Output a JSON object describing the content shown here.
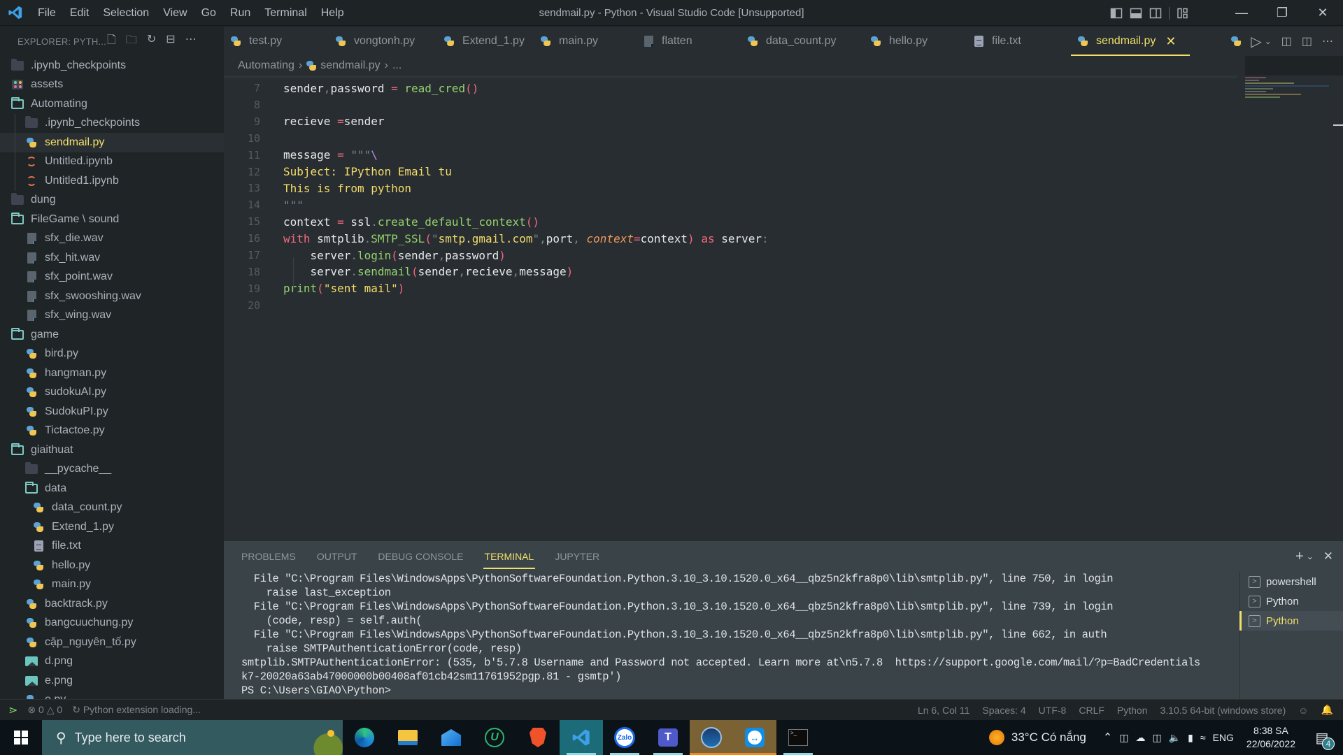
{
  "window": {
    "title": "sendmail.py - Python - Visual Studio Code [Unsupported]",
    "menu": [
      "File",
      "Edit",
      "Selection",
      "View",
      "Go",
      "Run",
      "Terminal",
      "Help"
    ]
  },
  "sidebar": {
    "header": "EXPLORER: PYTH...",
    "items": [
      {
        "label": ".ipynb_checkpoints",
        "icon": "folder-closed-icon",
        "depth": 0
      },
      {
        "label": "assets",
        "icon": "assets-folder-icon",
        "depth": 0
      },
      {
        "label": "Automating",
        "icon": "folder-open-icon",
        "depth": 0
      },
      {
        "label": ".ipynb_checkpoints",
        "icon": "folder-closed-icon",
        "depth": 1
      },
      {
        "label": "sendmail.py",
        "icon": "python-icon",
        "depth": 1,
        "active": true
      },
      {
        "label": "Untitled.ipynb",
        "icon": "notebook-icon",
        "depth": 1
      },
      {
        "label": "Untitled1.ipynb",
        "icon": "notebook-icon",
        "depth": 1
      },
      {
        "label": "dung",
        "icon": "folder-closed-icon",
        "depth": 0
      },
      {
        "label": "FileGame \\ sound",
        "icon": "folder-open-icon",
        "depth": 0
      },
      {
        "label": "sfx_die.wav",
        "icon": "file-icon",
        "depth": 1
      },
      {
        "label": "sfx_hit.wav",
        "icon": "file-icon",
        "depth": 1
      },
      {
        "label": "sfx_point.wav",
        "icon": "file-icon",
        "depth": 1
      },
      {
        "label": "sfx_swooshing.wav",
        "icon": "file-icon",
        "depth": 1
      },
      {
        "label": "sfx_wing.wav",
        "icon": "file-icon",
        "depth": 1
      },
      {
        "label": "game",
        "icon": "folder-open-icon",
        "depth": 0
      },
      {
        "label": "bird.py",
        "icon": "python-icon",
        "depth": 1
      },
      {
        "label": "hangman.py",
        "icon": "python-icon",
        "depth": 1
      },
      {
        "label": "sudokuAI.py",
        "icon": "python-icon",
        "depth": 1
      },
      {
        "label": "SudokuPI.py",
        "icon": "python-icon",
        "depth": 1
      },
      {
        "label": "Tictactoe.py",
        "icon": "python-icon",
        "depth": 1
      },
      {
        "label": "giaithuat",
        "icon": "folder-open-icon",
        "depth": 0
      },
      {
        "label": "__pycache__",
        "icon": "folder-closed-icon",
        "depth": 1
      },
      {
        "label": "data",
        "icon": "folder-open-icon",
        "depth": 1
      },
      {
        "label": "data_count.py",
        "icon": "python-icon",
        "depth": 2
      },
      {
        "label": "Extend_1.py",
        "icon": "python-icon",
        "depth": 2
      },
      {
        "label": "file.txt",
        "icon": "text-file-icon",
        "depth": 2
      },
      {
        "label": "hello.py",
        "icon": "python-icon",
        "depth": 2
      },
      {
        "label": "main.py",
        "icon": "python-icon",
        "depth": 2
      },
      {
        "label": "backtrack.py",
        "icon": "python-icon",
        "depth": 1
      },
      {
        "label": "bangcuuchung.py",
        "icon": "python-icon",
        "depth": 1
      },
      {
        "label": "cặp_nguyên_tố.py",
        "icon": "python-icon",
        "depth": 1
      },
      {
        "label": "d.png",
        "icon": "image-icon",
        "depth": 1
      },
      {
        "label": "e.png",
        "icon": "image-icon",
        "depth": 1
      },
      {
        "label": "e.py",
        "icon": "python-icon",
        "depth": 1
      }
    ]
  },
  "tabs": [
    {
      "label": "test.py",
      "icon": "python-icon"
    },
    {
      "label": "vongtonh.py",
      "icon": "python-icon"
    },
    {
      "label": "Extend_1.py",
      "icon": "python-icon"
    },
    {
      "label": "main.py",
      "icon": "python-icon"
    },
    {
      "label": "flatten",
      "icon": "file-icon"
    },
    {
      "label": "data_count.py",
      "icon": "python-icon"
    },
    {
      "label": "hello.py",
      "icon": "python-icon"
    },
    {
      "label": "file.txt",
      "icon": "text-file-icon"
    },
    {
      "label": "sendmail.py",
      "icon": "python-icon",
      "active": true
    }
  ],
  "breadcrumb": [
    "Automating",
    "sendmail.py",
    "..."
  ],
  "editor": {
    "lines": [
      {
        "n": "7",
        "tokens": [
          [
            "sender",
            ""
          ],
          [
            ",",
            "dim"
          ],
          [
            "password",
            ""
          ],
          [
            " = ",
            "op"
          ],
          [
            "read_cred",
            "fn"
          ],
          [
            "()",
            "par"
          ]
        ]
      },
      {
        "n": "8",
        "tokens": []
      },
      {
        "n": "9",
        "tokens": [
          [
            "recieve ",
            ""
          ],
          [
            "=",
            "op"
          ],
          [
            "sender",
            ""
          ]
        ]
      },
      {
        "n": "10",
        "tokens": []
      },
      {
        "n": "11",
        "tokens": [
          [
            "message ",
            ""
          ],
          [
            "= ",
            "op"
          ],
          [
            "\"\"\"",
            "dim"
          ],
          [
            "\\",
            "esc"
          ]
        ]
      },
      {
        "n": "12",
        "tokens": [
          [
            "Subject: IPython Email tu",
            "str"
          ]
        ]
      },
      {
        "n": "13",
        "tokens": [
          [
            "This is from python",
            "str"
          ]
        ]
      },
      {
        "n": "14",
        "tokens": [
          [
            "\"\"\"",
            "dim"
          ]
        ]
      },
      {
        "n": "15",
        "tokens": [
          [
            "context ",
            ""
          ],
          [
            "= ",
            "op"
          ],
          [
            "ssl",
            ""
          ],
          [
            ".",
            "dim"
          ],
          [
            "create_default_context",
            "fn"
          ],
          [
            "()",
            "par"
          ]
        ]
      },
      {
        "n": "16",
        "tokens": [
          [
            "with ",
            "kw"
          ],
          [
            "smtplib",
            ""
          ],
          [
            ".",
            "dim"
          ],
          [
            "SMTP_SSL",
            "fn"
          ],
          [
            "(",
            "par"
          ],
          [
            "\"",
            "dim"
          ],
          [
            "smtp.gmail.com",
            "str"
          ],
          [
            "\"",
            "dim"
          ],
          [
            ",",
            "dim"
          ],
          [
            "port",
            ""
          ],
          [
            ", ",
            "dim"
          ],
          [
            "context",
            "param"
          ],
          [
            "=",
            "op"
          ],
          [
            "context",
            ""
          ],
          [
            ")",
            "par"
          ],
          [
            " as ",
            "kw"
          ],
          [
            "server",
            ""
          ],
          [
            ":",
            "dim"
          ]
        ]
      },
      {
        "n": "17",
        "tokens": [
          [
            "    server",
            ""
          ],
          [
            ".",
            "dim"
          ],
          [
            "login",
            "fn"
          ],
          [
            "(",
            "par"
          ],
          [
            "sender",
            ""
          ],
          [
            ",",
            "dim"
          ],
          [
            "password",
            ""
          ],
          [
            ")",
            "par"
          ]
        ]
      },
      {
        "n": "18",
        "tokens": [
          [
            "    server",
            ""
          ],
          [
            ".",
            "dim"
          ],
          [
            "sendmail",
            "fn"
          ],
          [
            "(",
            "par"
          ],
          [
            "sender",
            ""
          ],
          [
            ",",
            "dim"
          ],
          [
            "recieve",
            ""
          ],
          [
            ",",
            "dim"
          ],
          [
            "message",
            ""
          ],
          [
            ")",
            "par"
          ]
        ]
      },
      {
        "n": "19",
        "tokens": [
          [
            "print",
            "fn"
          ],
          [
            "(",
            "par"
          ],
          [
            "\"sent mail\"",
            "str"
          ],
          [
            ")",
            "par"
          ]
        ]
      },
      {
        "n": "20",
        "tokens": []
      }
    ]
  },
  "panel": {
    "tabs": [
      "PROBLEMS",
      "OUTPUT",
      "DEBUG CONSOLE",
      "TERMINAL",
      "JUPYTER"
    ],
    "active_tab": "TERMINAL",
    "terminal_lines": [
      "  File \"C:\\Program Files\\WindowsApps\\PythonSoftwareFoundation.Python.3.10_3.10.1520.0_x64__qbz5n2kfra8p0\\lib\\smtplib.py\", line 750, in login",
      "    raise last_exception",
      "  File \"C:\\Program Files\\WindowsApps\\PythonSoftwareFoundation.Python.3.10_3.10.1520.0_x64__qbz5n2kfra8p0\\lib\\smtplib.py\", line 739, in login",
      "    (code, resp) = self.auth(",
      "  File \"C:\\Program Files\\WindowsApps\\PythonSoftwareFoundation.Python.3.10_3.10.1520.0_x64__qbz5n2kfra8p0\\lib\\smtplib.py\", line 662, in auth",
      "    raise SMTPAuthenticationError(code, resp)",
      "smtplib.SMTPAuthenticationError: (535, b'5.7.8 Username and Password not accepted. Learn more at\\n5.7.8  https://support.google.com/mail/?p=BadCredentials",
      "k7-20020a63ab47000000b00408af01cb42sm11761952pgp.81 - gsmtp')",
      "PS C:\\Users\\GIAO\\Python>"
    ],
    "terminals": [
      {
        "label": "powershell"
      },
      {
        "label": "Python"
      },
      {
        "label": "Python",
        "active": true
      }
    ]
  },
  "statusbar": {
    "errors": "0",
    "warnings": "0",
    "loading": "Python extension loading...",
    "position": "Ln 6, Col 11",
    "spaces": "Spaces: 4",
    "encoding": "UTF-8",
    "eol": "CRLF",
    "language": "Python",
    "interpreter": "3.10.5 64-bit (windows store)"
  },
  "taskbar": {
    "search_placeholder": "Type here to search",
    "weather": "33°C  Có nắng",
    "language": "ENG",
    "time": "8:38 SA",
    "date": "22/06/2022",
    "notifications": "4",
    "apps": [
      "edge",
      "file-explorer",
      "mail",
      "utorrent",
      "brave",
      "vscode",
      "zalo",
      "teams",
      "steam",
      "teamviewer",
      "terminal"
    ]
  },
  "colors": {
    "accent": "#f0e06a",
    "editor_bg": "#272d31",
    "sidebar_bg": "#1f2427",
    "panel_bg": "#3a4348"
  }
}
